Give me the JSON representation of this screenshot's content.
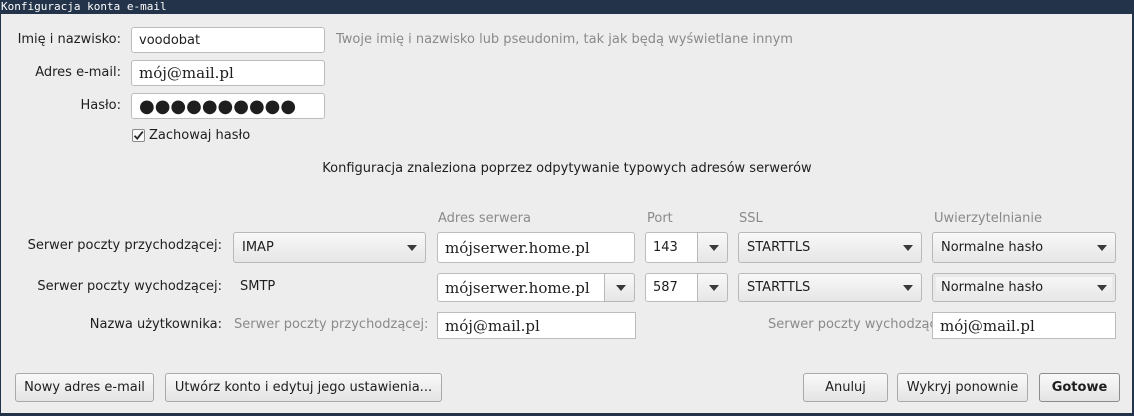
{
  "window": {
    "title": "Konfiguracja konta e-mail"
  },
  "identity": {
    "name_label": "Imię i nazwisko:",
    "name_value": "voodobat",
    "name_hint": "Twoje imię i nazwisko lub pseudonim, tak jak będą wyświetlane innym",
    "email_label": "Adres e-mail:",
    "email_value": "mój@mail.pl",
    "password_label": "Hasło:",
    "password_value": "●●●●●●●●●●",
    "remember_password_label": "Zachowaj hasło",
    "remember_password_checked": true
  },
  "status_message": "Konfiguracja znaleziona poprzez odpytywanie typowych adresów serwerów",
  "columns": {
    "server_address": "Adres serwera",
    "port": "Port",
    "ssl": "SSL",
    "auth": "Uwierzytelnianie"
  },
  "incoming": {
    "label": "Serwer poczty przychodzącej:",
    "protocol": "IMAP",
    "server": "mójserwer.home.pl",
    "port": "143",
    "ssl": "STARTTLS",
    "auth": "Normalne hasło"
  },
  "outgoing": {
    "label": "Serwer poczty wychodzącej:",
    "protocol": "SMTP",
    "server": "mójserwer.home.pl",
    "port": "587",
    "ssl": "STARTTLS",
    "auth": "Normalne hasło"
  },
  "username": {
    "label": "Nazwa użytkownika:",
    "incoming_label": "Serwer poczty przychodzącej:",
    "incoming_value": "mój@mail.pl",
    "outgoing_label": "Serwer poczty wychodzącej:",
    "outgoing_value": "mój@mail.pl"
  },
  "buttons": {
    "new_email": "Nowy adres e-mail",
    "create_and_edit": "Utwórz konto i edytuj jego ustawienia...",
    "cancel": "Anuluj",
    "redetect": "Wykryj ponownie",
    "done": "Gotowe"
  },
  "icons": {
    "checkbox": "checkmark-icon",
    "dropdown": "chevron-down-icon"
  }
}
